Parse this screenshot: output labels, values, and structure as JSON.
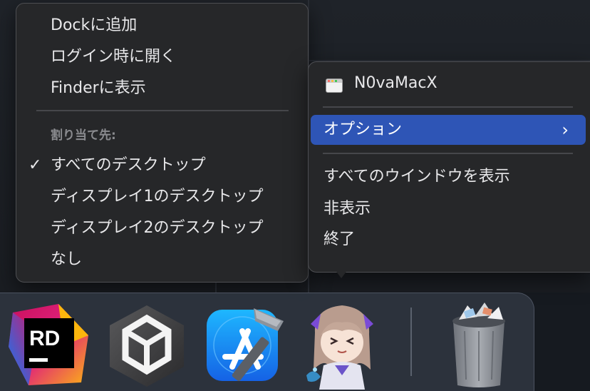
{
  "left_menu": {
    "items": [
      {
        "label": "Dockに追加"
      },
      {
        "label": "ログイン時に開く"
      },
      {
        "label": "Finderに表示"
      }
    ],
    "section_header": "割り当て先:",
    "assign_items": [
      {
        "label": "すべてのデスクトップ",
        "checked": true
      },
      {
        "label": "ディスプレイ1のデスクトップ",
        "checked": false
      },
      {
        "label": "ディスプレイ2のデスクトップ",
        "checked": false
      },
      {
        "label": "なし",
        "checked": false
      }
    ],
    "check_glyph": "✓"
  },
  "right_menu": {
    "window_item": {
      "label": "N0vaMacX",
      "icon": "window-icon"
    },
    "options": {
      "label": "オプション",
      "submenu_glyph": "›",
      "highlighted": true
    },
    "items": [
      {
        "label": "すべてのウインドウを表示"
      },
      {
        "label": "非表示"
      },
      {
        "label": "終了"
      }
    ]
  },
  "dock": {
    "apps": [
      {
        "name": "Rider",
        "icon": "rider-icon",
        "glyph": "RD"
      },
      {
        "name": "Unity",
        "icon": "unity-icon"
      },
      {
        "name": "Xcode",
        "icon": "xcode-icon"
      },
      {
        "name": "N0vaMacX",
        "icon": "anime-character-icon"
      },
      {
        "name": "Trash",
        "icon": "trash-icon"
      }
    ]
  },
  "colors": {
    "menu_bg": "#262729",
    "highlight": "#2e55b6",
    "dock_bg": "#303742"
  }
}
